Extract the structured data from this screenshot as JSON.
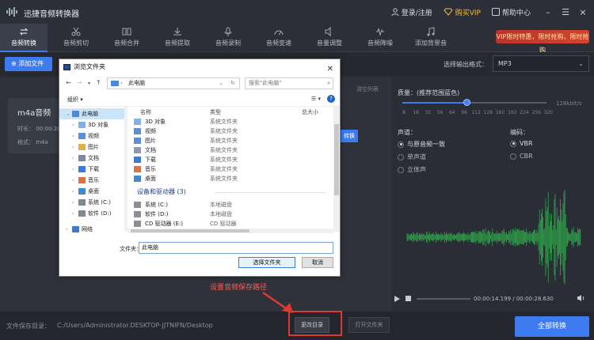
{
  "app": {
    "title": "迅捷音频转换器"
  },
  "titlebar": {
    "login": "登录/注册",
    "vip": "购买VIP",
    "help": "帮助中心",
    "min": "–",
    "max": "☰",
    "close": "×"
  },
  "tools": [
    {
      "label": "音频转换"
    },
    {
      "label": "音频剪切"
    },
    {
      "label": "音频合并"
    },
    {
      "label": "音频提取"
    },
    {
      "label": "音频录制"
    },
    {
      "label": "音频变速"
    },
    {
      "label": "音量调整"
    },
    {
      "label": "音频降噪"
    },
    {
      "label": "添加背景音"
    }
  ],
  "vip_banner": "VIP限时特惠，限时抢购，限时抢购",
  "subbar": {
    "add_file": "添加文件",
    "format_label": "选择输出格式：",
    "format_value": "MP3"
  },
  "file": {
    "title": "m4a音频",
    "duration": "时长：  00:00:28.6",
    "format": "格式：  m4a",
    "convert": "转换",
    "clear": "清空列表"
  },
  "settings": {
    "quality_label": "质量：(推荐范围蓝色)",
    "unit": "128kbit/s",
    "ticks": [
      "8",
      "16",
      "32",
      "56",
      "64",
      "96",
      "112",
      "128",
      "160",
      "192",
      "224",
      "256",
      "320"
    ],
    "channel_label": "声道：",
    "channels": [
      "与原音频一致",
      "单声道",
      "立体声"
    ],
    "encoding_label": "编码：",
    "encodings": [
      "VBR",
      "CBR"
    ]
  },
  "player": {
    "time": "00:00:14.199 / 00:00:28.630",
    "progress": 0.5
  },
  "bottom": {
    "save_label": "文件保存目录：",
    "save_path": "C:/Users/Administrator.DESKTOP-JJTNIFN/Desktop",
    "change_dir": "更改目录",
    "open_folder": "打开文件夹",
    "convert_all": "全部转换"
  },
  "annotation": "设置音频保存路径",
  "dialog": {
    "title": "浏览文件夹",
    "address": "此电脑",
    "search_placeholder": "搜索\"此电脑\"",
    "organize": "组织 ▾",
    "tree": [
      "此电脑",
      "3D 对象",
      "视频",
      "图片",
      "文档",
      "下载",
      "音乐",
      "桌面",
      "系统 (C:)",
      "软件 (D:)",
      "网络"
    ],
    "col_name": "名称",
    "col_type": "类型",
    "col_size": "总大小",
    "folders": [
      {
        "name": "3D 对象",
        "type": "系统文件夹"
      },
      {
        "name": "视频",
        "type": "系统文件夹"
      },
      {
        "name": "图片",
        "type": "系统文件夹"
      },
      {
        "name": "文档",
        "type": "系统文件夹"
      },
      {
        "name": "下载",
        "type": "系统文件夹"
      },
      {
        "name": "音乐",
        "type": "系统文件夹"
      },
      {
        "name": "桌面",
        "type": "系统文件夹"
      }
    ],
    "devices_group": "设备和驱动器 (3)",
    "devices": [
      {
        "name": "系统 (C:)",
        "type": "本地磁盘"
      },
      {
        "name": "软件 (D:)",
        "type": "本地磁盘"
      },
      {
        "name": "CD 驱动器 (E:)",
        "type": "CD 驱动器"
      }
    ],
    "folder_label": "文件夹：",
    "folder_value": "此电脑",
    "select_btn": "选择文件夹",
    "cancel_btn": "取消"
  }
}
